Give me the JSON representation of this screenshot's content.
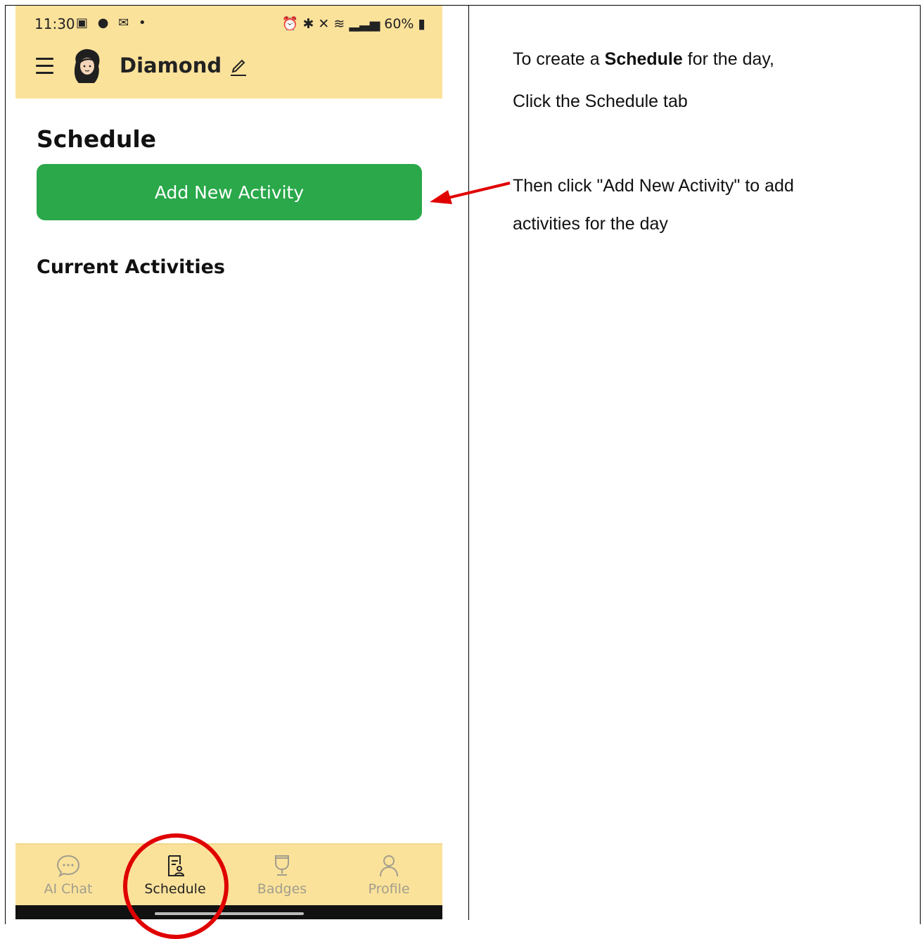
{
  "status_bar": {
    "time": "11:30",
    "left_icons": [
      "image-icon",
      "chat-icon",
      "mail-icon",
      "dot-icon"
    ],
    "battery": "60%"
  },
  "app_bar": {
    "title": "Diamond"
  },
  "schedule": {
    "title": "Schedule",
    "add_button_label": "Add New Activity",
    "current_title": "Current Activities"
  },
  "bottom_nav": [
    {
      "label": "AI Chat",
      "icon": "chat-bubble-icon",
      "active": false
    },
    {
      "label": "Schedule",
      "icon": "schedule-icon",
      "active": true
    },
    {
      "label": "Badges",
      "icon": "trophy-icon",
      "active": false
    },
    {
      "label": "Profile",
      "icon": "person-icon",
      "active": false
    }
  ],
  "instructions": {
    "line1_pre": "To create a ",
    "line1_bold": "Schedule",
    "line1_post": " for the day,",
    "line2": "Click the Schedule tab",
    "line3": "Then click \"Add New Activity\" to add",
    "line4": "activities for the day"
  },
  "colors": {
    "app_bar": "#fbe29b",
    "primary_button": "#2aa84a",
    "annotation": "#e00000"
  }
}
